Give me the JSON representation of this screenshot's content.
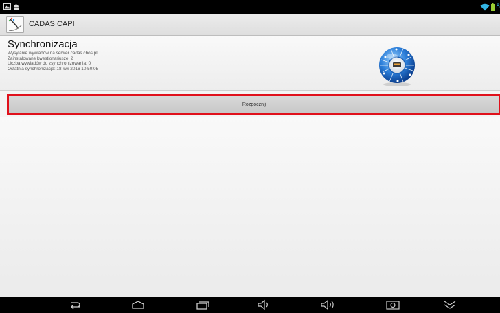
{
  "status_bar": {
    "battery_text": "8"
  },
  "app_bar": {
    "title": "CADAS CAPI",
    "icon": "app-logo-icon"
  },
  "sync": {
    "heading": "Synchronizacja",
    "lines": [
      "Wysyłanie wywiadów na serwer cadas.cbos.pl.",
      "Zainstalowane kwestionariusze: 2",
      "Liczba wywiadów do zsynchronizowania: 0",
      "Ostatnia synchronizacja: 18 kwi 2016 10:50:05"
    ],
    "graphic": "network-globe-icon"
  },
  "start_button": {
    "label": "Rozpocznij"
  },
  "nav_bar": {
    "buttons": [
      "back-icon",
      "home-icon",
      "recents-icon",
      "volume-down-icon",
      "volume-up-icon",
      "screenshot-icon",
      "hide-keyboard-icon"
    ]
  },
  "colors": {
    "accent": "#33b5e5",
    "highlight_border": "#e0101b"
  }
}
